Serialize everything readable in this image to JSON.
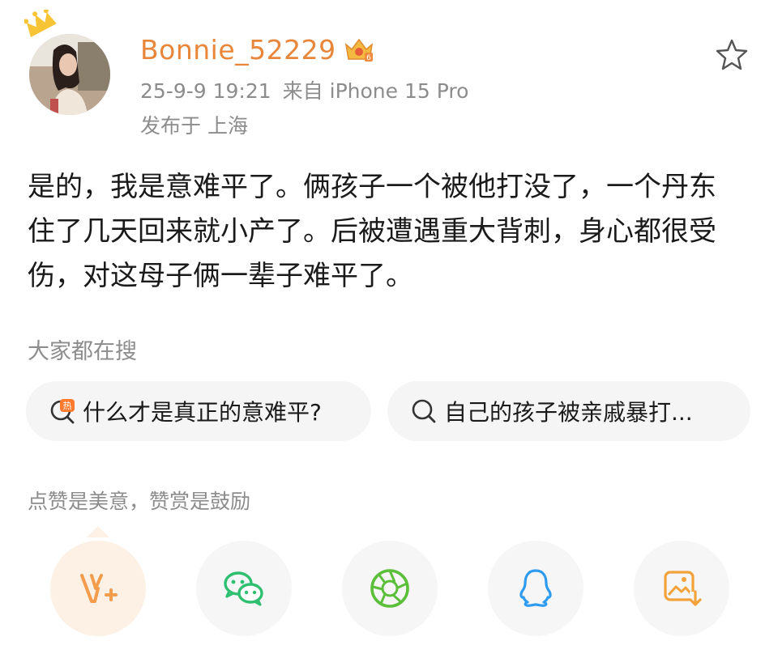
{
  "post": {
    "author": {
      "username": "Bonnie_52229",
      "avatar": "avatar-photo",
      "crown_icon": "crown-icon",
      "vip_badge_icon": "vip-crown-badge-icon"
    },
    "timestamp": "25-9-9 19:21",
    "source": "来自 iPhone 15 Pro",
    "location": "发布于 上海",
    "content": "是的，我是意难平了。俩孩子一个被他打没了，一个丹东住了几天回来就小产了。后被遭遇重大背刺，身心都很受伤，对这母子俩一辈子难平了。",
    "favorite_icon": "star-outline-icon"
  },
  "trending_search": {
    "title": "大家都在搜",
    "chips": [
      {
        "icon": "hot-search-icon",
        "text": "什么才是真正的意难平?"
      },
      {
        "icon": "search-icon",
        "text": "自己的孩子被亲戚暴打..."
      }
    ]
  },
  "reward": {
    "hint": "点赞是美意，赞赏是鼓励"
  },
  "share_bar": {
    "buttons": [
      {
        "name": "reward",
        "icon": "reward-v-plus-icon",
        "color": "#f39c4b"
      },
      {
        "name": "wechat",
        "icon": "wechat-icon",
        "color": "#2fbf71"
      },
      {
        "name": "moments",
        "icon": "moments-aperture-icon",
        "color": "#5cbf3a"
      },
      {
        "name": "qq",
        "icon": "qq-penguin-icon",
        "color": "#2e9bf0"
      },
      {
        "name": "save-image",
        "icon": "save-image-icon",
        "color": "#f2a23a"
      }
    ]
  },
  "colors": {
    "username": "#e8863a",
    "meta": "#8c8c8c",
    "text": "#1a1a1a",
    "chip_bg": "#f5f5f5",
    "reward_bg": "#fdf1e6"
  }
}
